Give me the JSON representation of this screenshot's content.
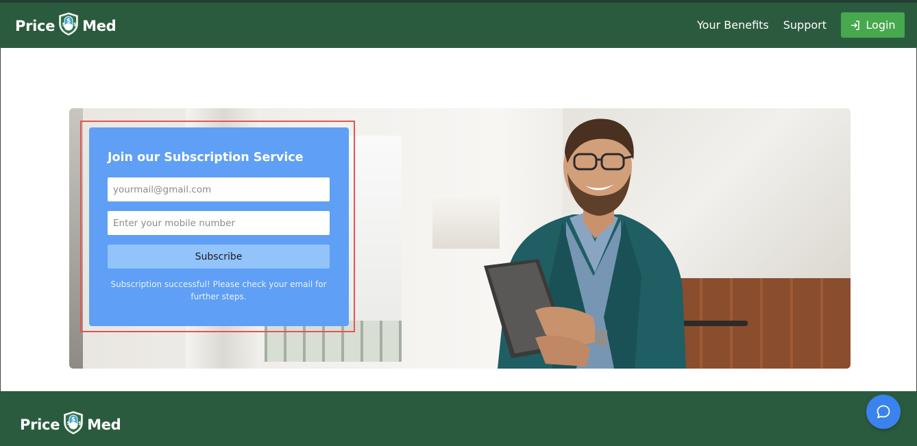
{
  "header": {
    "logo_left": "Price",
    "logo_right": "Med",
    "nav": [
      "Your Benefits",
      "Support"
    ],
    "login_label": "Login"
  },
  "subscription": {
    "title": "Join our Subscription Service",
    "email_placeholder": "yourmail@gmail.com",
    "mobile_placeholder": "Enter your mobile number",
    "button_label": "Subscribe",
    "status_message": "Subscription successful! Please check your email for further steps."
  },
  "footer": {
    "logo_left": "Price",
    "logo_right": "Med"
  },
  "colors": {
    "brand_green": "#2b5b3f",
    "login_green": "#47a84e",
    "card_blue": "#5f9ff5",
    "button_blue": "#92c3fb",
    "highlight_red": "#e35552",
    "chat_blue": "#3a83ee"
  },
  "icons": {
    "logo_badge": "shield-pill-icon",
    "login": "login-arrow-icon",
    "chat": "chat-bubble-icon"
  }
}
